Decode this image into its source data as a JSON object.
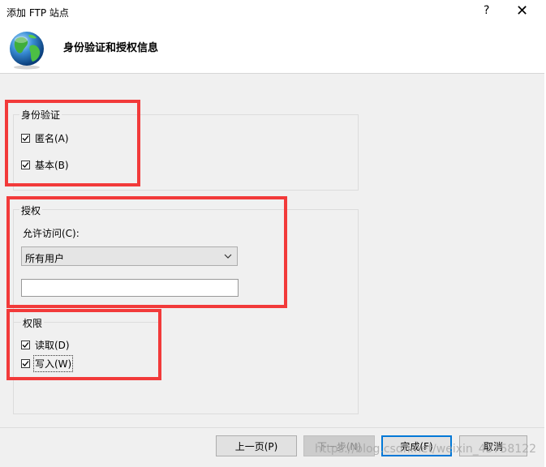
{
  "window": {
    "title": "添加 FTP 站点",
    "help": "?",
    "close": "✕"
  },
  "header": {
    "title": "身份验证和授权信息"
  },
  "auth": {
    "legend": "身份验证",
    "anonymous": {
      "label": "匿名(A)",
      "checked": true
    },
    "basic": {
      "label": "基本(B)",
      "checked": true
    }
  },
  "authorization": {
    "legend": "授权",
    "allow_label": "允许访问(C):",
    "select_value": "所有用户",
    "input_value": ""
  },
  "permissions": {
    "legend": "权限",
    "read": {
      "label": "读取(D)",
      "checked": true
    },
    "write": {
      "label": "写入(W)",
      "checked": true
    }
  },
  "buttons": {
    "prev": "上一页(P)",
    "next": "下一步(N)",
    "finish": "完成(F)",
    "cancel": "取消"
  },
  "watermark": "https://blog.csdn.net/weixin_43758122",
  "colors": {
    "highlight": "#f23a3a",
    "accent": "#0078d7"
  }
}
